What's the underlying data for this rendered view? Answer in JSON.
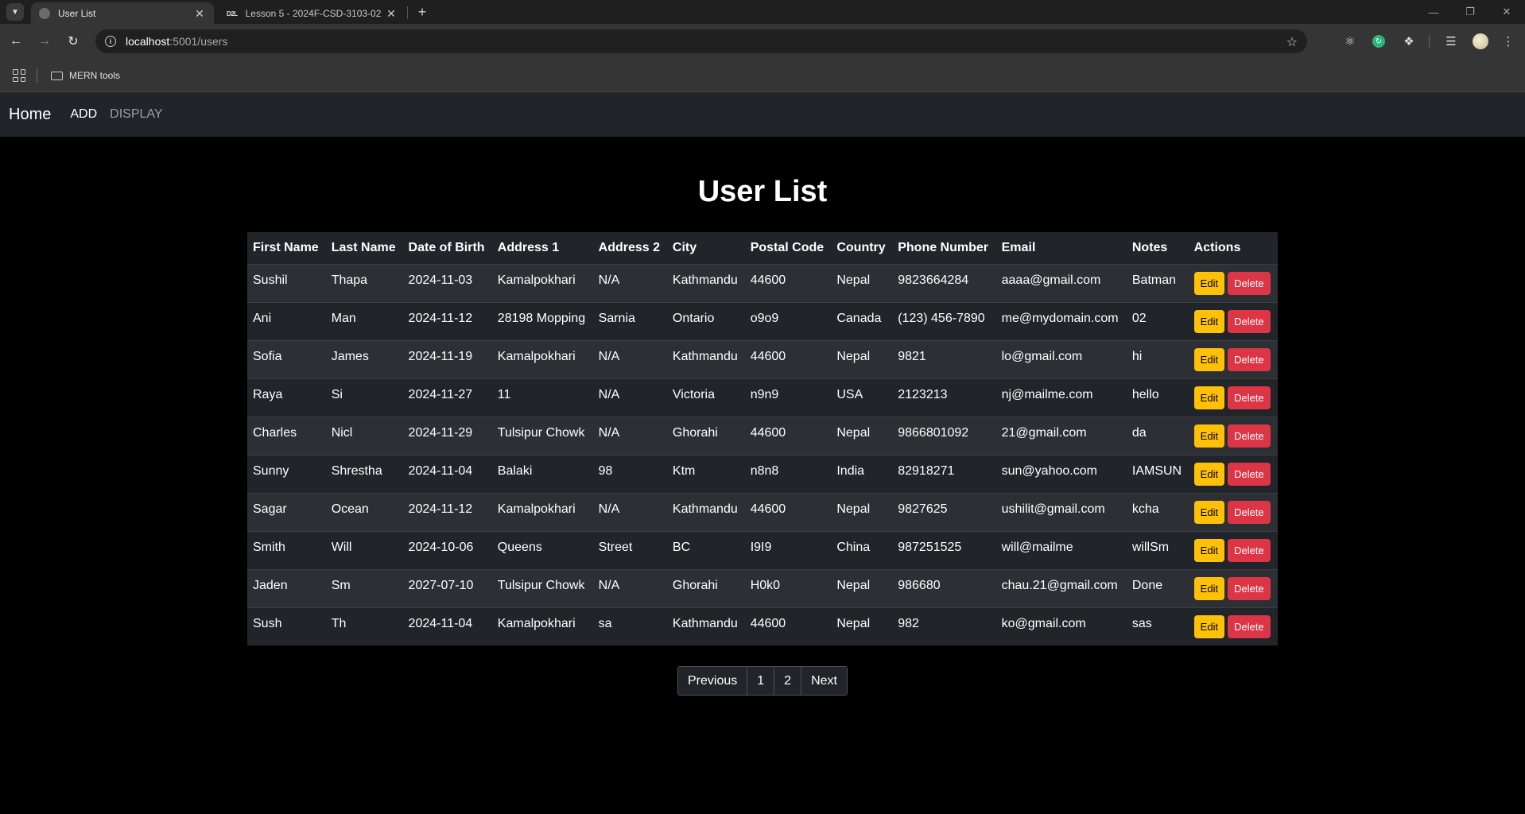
{
  "browser": {
    "tabs": [
      {
        "title": "User List",
        "active": true
      },
      {
        "title": "Lesson 5 - 2024F-CSD-3103-02",
        "active": false
      }
    ],
    "d2l_favicon": "D2L",
    "url_host": "localhost",
    "url_path": ":5001/users",
    "bookmark_folder": "MERN tools"
  },
  "navbar": {
    "brand": "Home",
    "links": [
      "ADD",
      "DISPLAY"
    ]
  },
  "page": {
    "title": "User List"
  },
  "table": {
    "headers": [
      "First Name",
      "Last Name",
      "Date of Birth",
      "Address 1",
      "Address 2",
      "City",
      "Postal Code",
      "Country",
      "Phone Number",
      "Email",
      "Notes",
      "Actions"
    ],
    "rows": [
      [
        "Sushil",
        "Thapa",
        "2024-11-03",
        "Kamalpokhari",
        "N/A",
        "Kathmandu",
        "44600",
        "Nepal",
        "9823664284",
        "aaaa@gmail.com",
        "Batman"
      ],
      [
        "Ani",
        "Man",
        "2024-11-12",
        "28198 Mopping",
        "Sarnia",
        "Ontario",
        "o9o9",
        "Canada",
        "(123) 456-7890",
        "me@mydomain.com",
        "02"
      ],
      [
        "Sofia",
        "James",
        "2024-11-19",
        "Kamalpokhari",
        "N/A",
        "Kathmandu",
        "44600",
        "Nepal",
        "9821",
        "lo@gmail.com",
        "hi"
      ],
      [
        "Raya",
        "Si",
        "2024-11-27",
        "11",
        "N/A",
        "Victoria",
        "n9n9",
        "USA",
        "2123213",
        "nj@mailme.com",
        "hello"
      ],
      [
        "Charles",
        "Nicl",
        "2024-11-29",
        "Tulsipur Chowk",
        "N/A",
        "Ghorahi",
        "44600",
        "Nepal",
        "9866801092",
        "21@gmail.com",
        "da"
      ],
      [
        "Sunny",
        "Shrestha",
        "2024-11-04",
        "Balaki",
        "98",
        "Ktm",
        "n8n8",
        "India",
        "82918271",
        "sun@yahoo.com",
        "IAMSUN"
      ],
      [
        "Sagar",
        "Ocean",
        "2024-11-12",
        "Kamalpokhari",
        "N/A",
        "Kathmandu",
        "44600",
        "Nepal",
        "9827625",
        "ushilit@gmail.com",
        "kcha"
      ],
      [
        "Smith",
        "Will",
        "2024-10-06",
        "Queens",
        "Street",
        "BC",
        "I9I9",
        "China",
        "987251525",
        "will@mailme",
        "willSm"
      ],
      [
        "Jaden",
        "Sm",
        "2027-07-10",
        "Tulsipur Chowk",
        "N/A",
        "Ghorahi",
        "H0k0",
        "Nepal",
        "986680",
        "chau.21@gmail.com",
        "Done"
      ],
      [
        "Sush",
        "Th",
        "2024-11-04",
        "Kamalpokhari",
        "sa",
        "Kathmandu",
        "44600",
        "Nepal",
        "982",
        "ko@gmail.com",
        "sas"
      ]
    ],
    "edit_label": "Edit",
    "delete_label": "Delete"
  },
  "pagination": [
    "Previous",
    "1",
    "2",
    "Next"
  ],
  "colors": {
    "edit": "#ffc107",
    "delete": "#dc3545",
    "navbar": "#212529"
  }
}
